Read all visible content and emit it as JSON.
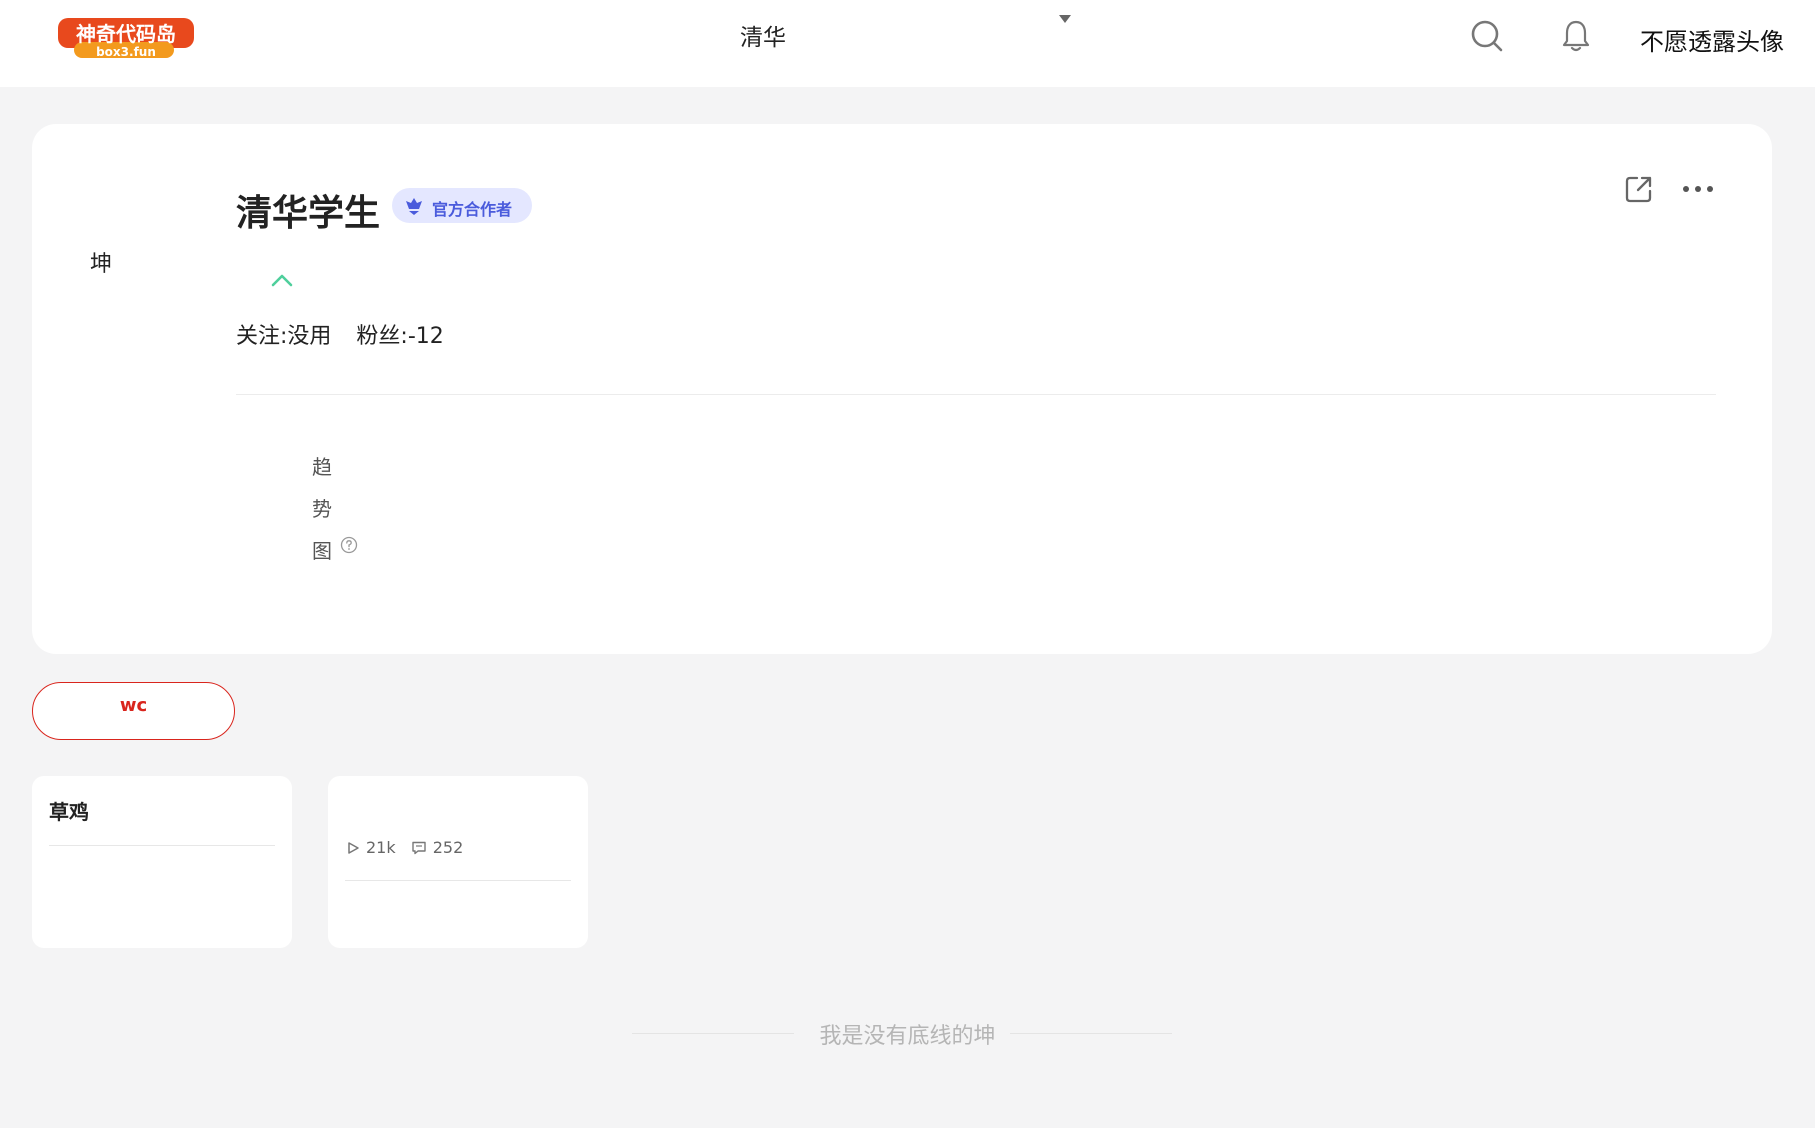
{
  "header": {
    "logo_text": "神奇代码岛",
    "logo_subtext": "box3.fun",
    "nav_title": "清华",
    "user_name": "不愿透露头像"
  },
  "profile": {
    "avatar_alt": "坤",
    "name": "清华学生",
    "badge": "官方合作者",
    "stats": {
      "following": "关注:没用",
      "followers": "粉丝:-12"
    },
    "trend_chars": [
      "趋",
      "势",
      "图"
    ]
  },
  "tabs": [
    {
      "label": "wc",
      "active": true
    }
  ],
  "cards": [
    {
      "title": "草鸡"
    },
    {
      "title": "",
      "plays": "21k",
      "comments": "252"
    }
  ],
  "footer": {
    "text": "我是没有底线的坤"
  },
  "colors": {
    "accent_red": "#d9251d",
    "badge_bg": "#e4e7ff",
    "badge_text": "#4a5bdc",
    "collapse_green": "#4fcf9c",
    "page_bg": "#f4f4f5"
  }
}
